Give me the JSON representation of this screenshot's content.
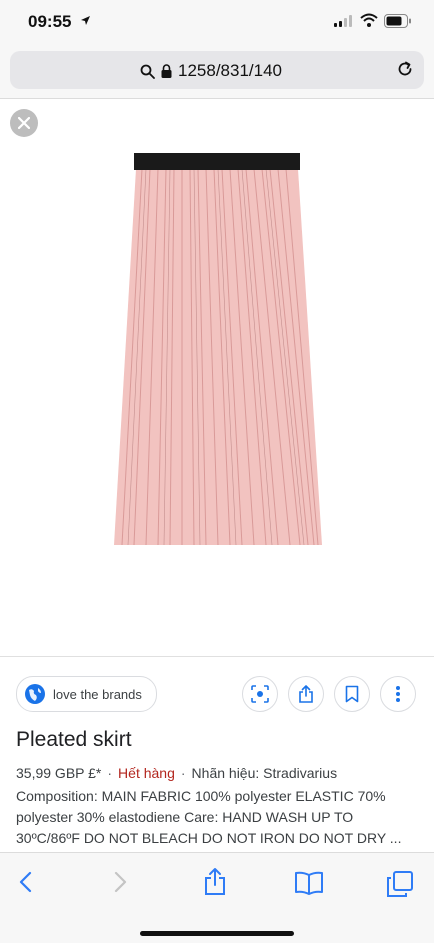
{
  "status_bar": {
    "time": "09:55"
  },
  "browser": {
    "url": "1258/831/140"
  },
  "image_viewer": {
    "source": {
      "name": "love the brands",
      "icon": "globe-icon"
    },
    "actions": [
      "lens-icon",
      "share-icon",
      "bookmark-icon",
      "more-icon"
    ],
    "product": {
      "title": "Pleated skirt",
      "price": "35,99 GBP £*",
      "stock_status": "Hết hàng",
      "brand": "Nhãn hiệu: Stradivarius",
      "description": "Composition: MAIN FABRIC 100% polyester ELASTIC 70% polyester 30% elastodiene Care: HAND WASH UP TO 30ºC/86ºF DO NOT BLEACH DO NOT IRON DO NOT DRY ..."
    }
  },
  "toolbar": {
    "items": [
      "back-icon",
      "forward-icon",
      "share-icon",
      "bookmarks-icon",
      "tabs-icon"
    ]
  },
  "colors": {
    "skirt": "#f2c2c0",
    "waistband": "#1a1a1a",
    "stock": "#b3261e",
    "ios_blue": "#2f7cf6"
  }
}
